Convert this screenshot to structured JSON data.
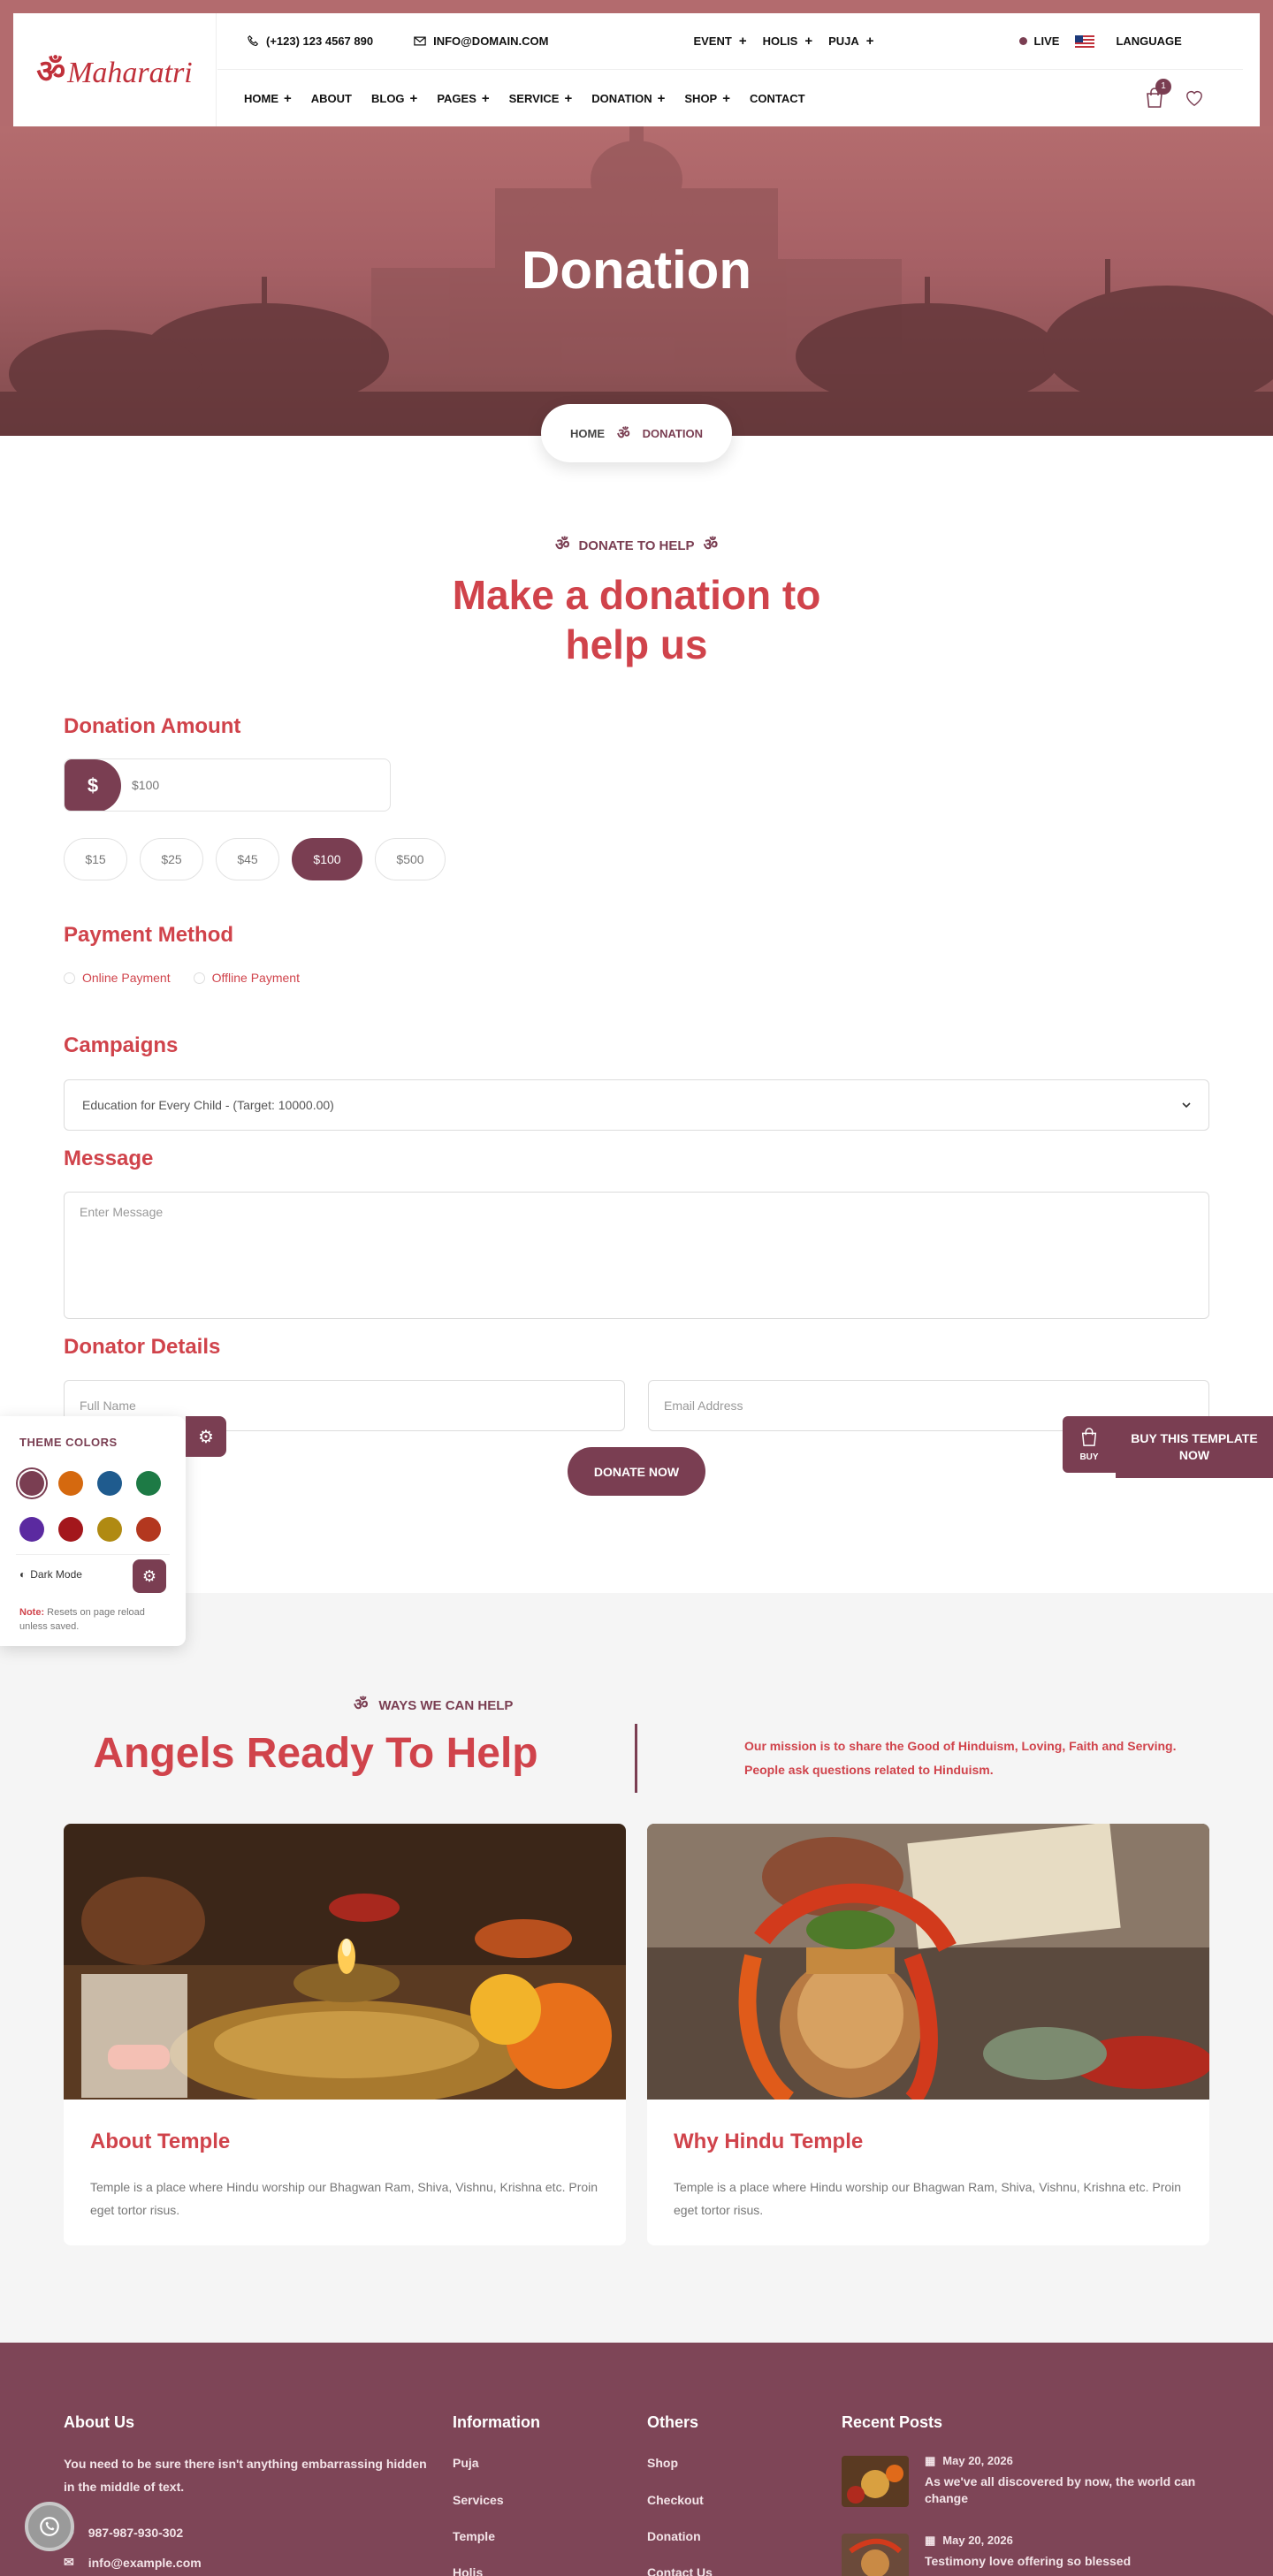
{
  "header": {
    "logo_text": "Maharatri",
    "logo_om": "ॐ",
    "phone": "(+123) 123 4567 890",
    "email": "INFO@DOMAIN.COM",
    "top_menu": [
      {
        "label": "EVENT"
      },
      {
        "label": "HOLIS"
      },
      {
        "label": "PUJA"
      }
    ],
    "live_label": "LIVE",
    "language_label": "LANGUAGE",
    "nav": [
      {
        "label": "HOME",
        "has_plus": true
      },
      {
        "label": "ABOUT",
        "has_plus": false
      },
      {
        "label": "BLOG",
        "has_plus": true
      },
      {
        "label": "PAGES",
        "has_plus": true
      },
      {
        "label": "SERVICE",
        "has_plus": true
      },
      {
        "label": "DONATION",
        "has_plus": true
      },
      {
        "label": "SHOP",
        "has_plus": true
      },
      {
        "label": "CONTACT",
        "has_plus": false
      }
    ],
    "cart_count": "1"
  },
  "hero": {
    "title": "Donation",
    "breadcrumb_home": "HOME",
    "breadcrumb_sep": "ॐ",
    "breadcrumb_current": "DONATION"
  },
  "donate": {
    "sub_label": "DONATE TO HELP",
    "heading_line1": "Make a donation to",
    "heading_line2": "help us",
    "amount_label": "Donation Amount",
    "currency": "$",
    "amount_placeholder": "$100",
    "chips": [
      "$15",
      "$25",
      "$45",
      "$100",
      "$500"
    ],
    "active_chip": "$100",
    "payment_label": "Payment Method",
    "payment_options": [
      "Online Payment",
      "Offline Payment"
    ],
    "campaigns_label": "Campaigns",
    "campaign_selected": "Education for Every Child - (Target: 10000.00)",
    "message_label": "Message",
    "message_placeholder": "Enter Message",
    "donator_label": "Donator Details",
    "name_placeholder": "Full Name",
    "email_placeholder": "Email Address",
    "donate_button": "DONATE NOW"
  },
  "theme_panel": {
    "title": "THEME COLORS",
    "colors": [
      "#7a3e52",
      "#d5690f",
      "#1f5b8e",
      "#1d7a45",
      "#5b2aa0",
      "#a3171c",
      "#b08a12",
      "#b3371f"
    ],
    "dark_mode_label": "Dark Mode",
    "note_label": "Note:",
    "note_text": "Resets on page reload unless saved."
  },
  "buy": {
    "icon_label": "BUY",
    "text": "BUY THIS TEMPLATE NOW"
  },
  "help": {
    "sub_label": "WAYS WE CAN HELP",
    "heading": "Angels Ready To Help",
    "mission_line1": "Our mission is to share the Good of Hinduism, Loving, Faith and Serving.",
    "mission_line2": "People ask questions related to Hinduism.",
    "cards": [
      {
        "title": "About Temple",
        "text": "Temple is a place where Hindu worship our Bhagwan Ram, Shiva, Vishnu, Krishna etc. Proin eget tortor risus."
      },
      {
        "title": "Why Hindu Temple",
        "text": "Temple is a place where Hindu worship our Bhagwan Ram, Shiva, Vishnu, Krishna etc. Proin eget tortor risus."
      }
    ]
  },
  "footer": {
    "about_title": "About Us",
    "about_text": "You need to be sure there isn't anything embarrassing hidden in the middle of text.",
    "phone": "987-987-930-302",
    "email": "info@example.com",
    "info_title": "Information",
    "info_links": [
      "Puja",
      "Services",
      "Temple",
      "Holis"
    ],
    "others_title": "Others",
    "others_links": [
      "Shop",
      "Checkout",
      "Donation",
      "Contact Us"
    ],
    "posts_title": "Recent Posts",
    "posts": [
      {
        "date": "May 20, 2026",
        "title": "As we've all discovered by now, the world can change"
      },
      {
        "date": "May 20, 2026",
        "title": "Testimony love offering so blessed"
      }
    ]
  }
}
